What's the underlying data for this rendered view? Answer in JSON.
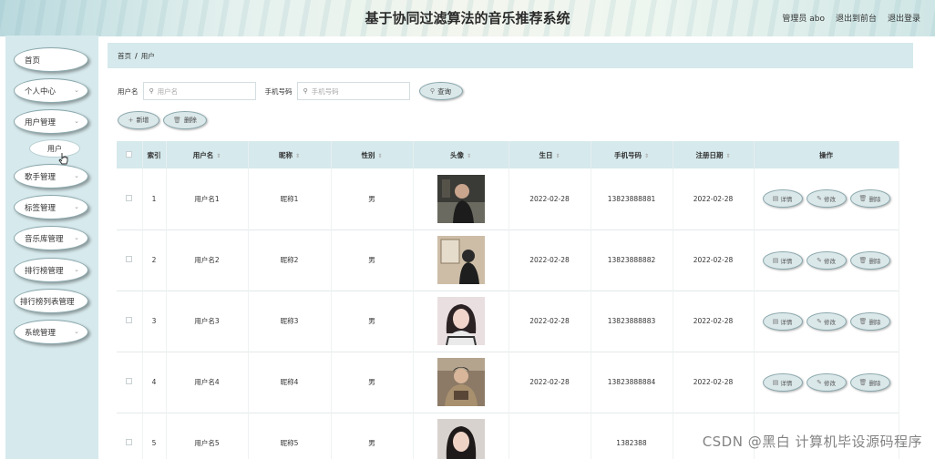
{
  "header": {
    "title": "基于协同过滤算法的音乐推荐系统",
    "admin_label": "管理员 abo",
    "to_front": "退出到前台",
    "logout": "退出登录"
  },
  "sidebar": {
    "items": [
      {
        "label": "首页",
        "has_chevron": false
      },
      {
        "label": "个人中心",
        "has_chevron": true
      },
      {
        "label": "用户管理",
        "has_chevron": true
      },
      {
        "label": "歌手管理",
        "has_chevron": true
      },
      {
        "label": "标签管理",
        "has_chevron": true
      },
      {
        "label": "音乐库管理",
        "has_chevron": true
      },
      {
        "label": "排行榜管理",
        "has_chevron": true
      },
      {
        "label": "排行榜列表管理",
        "has_chevron": false
      },
      {
        "label": "系统管理",
        "has_chevron": true
      }
    ],
    "sub_item": "用户"
  },
  "breadcrumb": {
    "home": "首页",
    "sep": "/",
    "current": "用户"
  },
  "search": {
    "username_label": "用户名",
    "username_placeholder": "用户名",
    "phone_label": "手机号码",
    "phone_placeholder": "手机号码",
    "button": "查询"
  },
  "actions": {
    "add": "新增",
    "delete": "删除"
  },
  "table": {
    "headers": [
      "索引",
      "用户名",
      "昵称",
      "性别",
      "头像",
      "生日",
      "手机号码",
      "注册日期",
      "操作"
    ],
    "rows": [
      {
        "index": "1",
        "username": "用户名1",
        "nickname": "昵称1",
        "gender": "男",
        "birthday": "2022-02-28",
        "phone": "13823888881",
        "reg_date": "2022-02-28"
      },
      {
        "index": "2",
        "username": "用户名2",
        "nickname": "昵称2",
        "gender": "男",
        "birthday": "2022-02-28",
        "phone": "13823888882",
        "reg_date": "2022-02-28"
      },
      {
        "index": "3",
        "username": "用户名3",
        "nickname": "昵称3",
        "gender": "男",
        "birthday": "2022-02-28",
        "phone": "13823888883",
        "reg_date": "2022-02-28"
      },
      {
        "index": "4",
        "username": "用户名4",
        "nickname": "昵称4",
        "gender": "男",
        "birthday": "2022-02-28",
        "phone": "13823888884",
        "reg_date": "2022-02-28"
      },
      {
        "index": "5",
        "username": "用户名5",
        "nickname": "昵称5",
        "gender": "男",
        "birthday": "",
        "phone": "1382388",
        "reg_date": ""
      }
    ],
    "row_actions": {
      "detail": "详情",
      "edit": "修改",
      "delete": "删除"
    }
  },
  "watermark": "CSDN @黑白  计算机毕设源码程序",
  "colors": {
    "panel_bg": "#d6e9ec",
    "button_bg": "#dbe8ea",
    "button_border": "#8aa8ad"
  }
}
